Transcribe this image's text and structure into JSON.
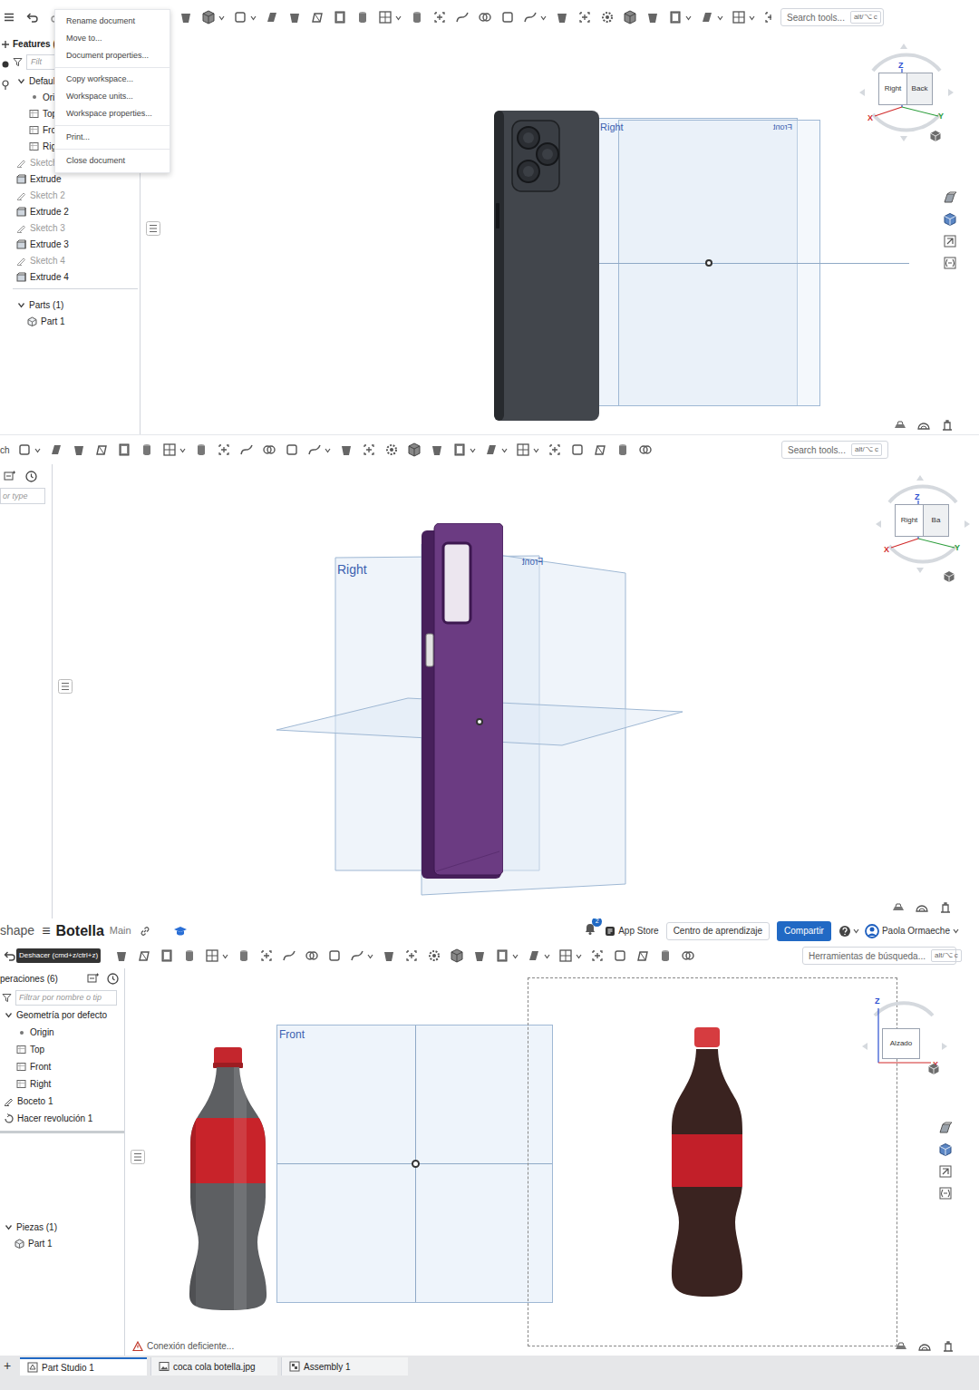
{
  "screen1": {
    "menu": {
      "sections": [
        [
          "Rename document",
          "Move to...",
          "Document properties..."
        ],
        [
          "Copy workspace...",
          "Workspace units...",
          "Workspace properties..."
        ],
        [
          "Print..."
        ],
        [
          "Close document"
        ]
      ]
    },
    "search": {
      "label": "Search tools...",
      "shortcut": "alt/⌥ c"
    },
    "tree": {
      "header": "Features (",
      "filter_placeholder": "Filt",
      "items": [
        {
          "label": "Default",
          "kind": "group",
          "expanded": true,
          "hidden": false
        },
        {
          "label": "Orig",
          "kind": "origin",
          "hidden": false
        },
        {
          "label": "Top",
          "kind": "plane",
          "hidden": false
        },
        {
          "label": "Fro",
          "kind": "plane",
          "hidden": false
        },
        {
          "label": "Rig",
          "kind": "plane",
          "hidden": false
        },
        {
          "label": "Sketch",
          "kind": "sketch",
          "hidden": true
        },
        {
          "label": "Extrude",
          "kind": "feature",
          "hidden": false
        },
        {
          "label": "Sketch 2",
          "kind": "sketch",
          "hidden": true
        },
        {
          "label": "Extrude 2",
          "kind": "feature",
          "hidden": false
        },
        {
          "label": "Sketch 3",
          "kind": "sketch",
          "hidden": true
        },
        {
          "label": "Extrude 3",
          "kind": "feature",
          "hidden": false
        },
        {
          "label": "Sketch 4",
          "kind": "sketch",
          "hidden": true
        },
        {
          "label": "Extrude 4",
          "kind": "feature",
          "hidden": false
        }
      ]
    },
    "parts": {
      "label": "Parts (1)",
      "expanded": true,
      "items": [
        "Part 1"
      ]
    },
    "planes": {
      "right": "Right",
      "front": "Front"
    },
    "view_cube": {
      "faces": [
        "Right",
        "Back"
      ],
      "axes": [
        "Z",
        "X",
        "Y"
      ]
    }
  },
  "screen2": {
    "toolbar_prefix": "ch",
    "search": {
      "label": "Search tools...",
      "shortcut": "alt/⌥ c"
    },
    "filter_placeholder": "or type",
    "planes": {
      "right": "Right",
      "front": "Front"
    },
    "view_cube": {
      "faces": [
        "Right",
        "Ba"
      ],
      "axes": [
        "Z",
        "X",
        "Y"
      ]
    }
  },
  "screen3": {
    "header": {
      "app": "shape",
      "menu_icon": "≡",
      "title": "Botella",
      "branch": "Main",
      "notifications": "2",
      "app_store": "App Store",
      "learning": "Centro de aprendizaje",
      "share": "Compartir",
      "user": "Paola Ormaeche"
    },
    "tooltip": "Deshacer (cmd+z/ctrl+z)",
    "search": {
      "label": "Herramientas de búsqueda...",
      "shortcut": "alt/⌥ c"
    },
    "tree": {
      "header": "peraciones (6)",
      "filter_placeholder": "Filtrar por nombre o tip",
      "items": [
        {
          "label": "Geometría por defecto",
          "kind": "group",
          "expanded": true,
          "hidden": false
        },
        {
          "label": "Origin",
          "kind": "origin",
          "hidden": false
        },
        {
          "label": "Top",
          "kind": "plane",
          "hidden": false
        },
        {
          "label": "Front",
          "kind": "plane",
          "hidden": false
        },
        {
          "label": "Right",
          "kind": "plane",
          "hidden": false
        },
        {
          "label": "Boceto 1",
          "kind": "sketch",
          "hidden": false
        },
        {
          "label": "Hacer revolución 1",
          "kind": "revolve",
          "hidden": false
        }
      ]
    },
    "parts": {
      "label": "Piezas (1)",
      "expanded": true,
      "items": [
        "Part 1"
      ]
    },
    "plane": "Front",
    "view_cube": {
      "faces": [
        "Alzado"
      ],
      "axes": [
        "Z",
        "X"
      ]
    },
    "status": "Conexión deficiente...",
    "add_tab": "+",
    "tabs": [
      {
        "label": "Part Studio 1",
        "kind": "part-studio",
        "selected": true
      },
      {
        "label": "coca cola botella.jpg",
        "kind": "image",
        "selected": false
      },
      {
        "label": "Assembly 1",
        "kind": "assembly",
        "selected": false
      }
    ]
  }
}
